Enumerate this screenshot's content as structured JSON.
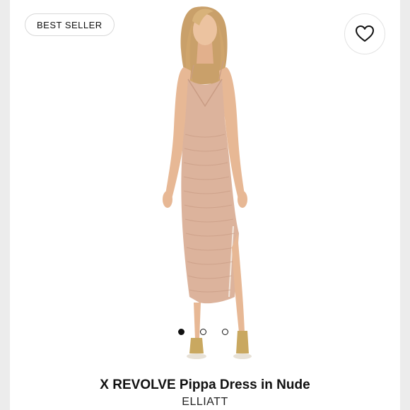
{
  "badge": {
    "label": "BEST SELLER"
  },
  "favorite": {
    "icon": "heart-icon"
  },
  "carousel": {
    "total_slides": 3,
    "active_slide": 1
  },
  "product": {
    "title": "X REVOLVE Pippa Dress in Nude",
    "brand": "ELLIATT"
  },
  "colors": {
    "dress": "#dcb39c",
    "skin": "#e7b895",
    "hair": "#c9a06a",
    "heels": "#c9a860"
  }
}
